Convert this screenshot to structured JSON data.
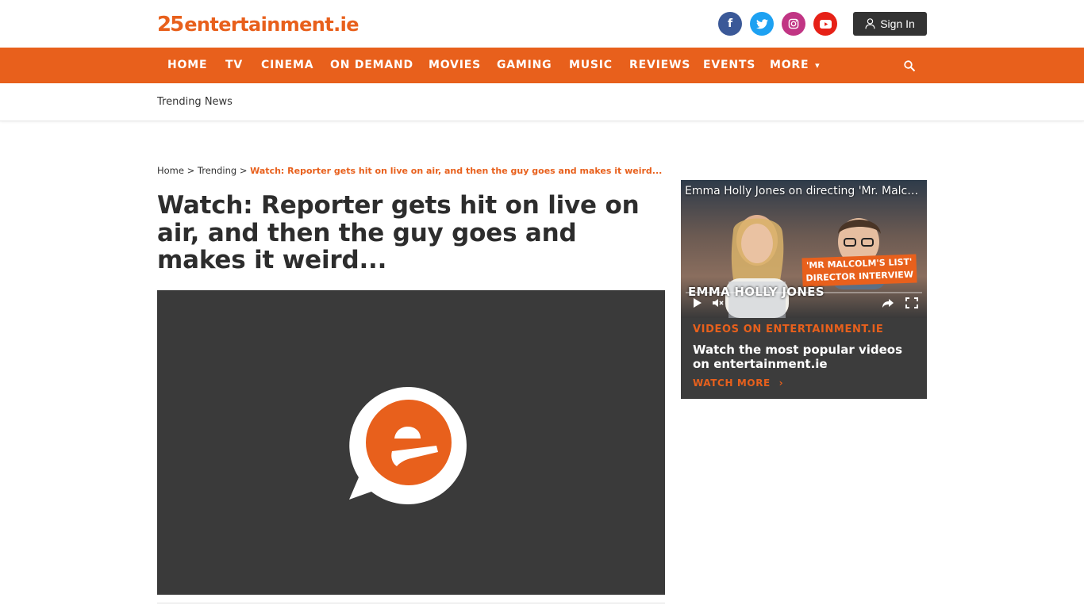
{
  "header": {
    "logo_number": "25",
    "logo_text": "entertainment.ie",
    "social": [
      {
        "icon": "facebook-icon",
        "glyph": "f"
      },
      {
        "icon": "twitter-icon",
        "glyph": ""
      },
      {
        "icon": "instagram-icon",
        "glyph": ""
      },
      {
        "icon": "youtube-icon",
        "glyph": ""
      }
    ],
    "signin_label": "Sign In"
  },
  "nav": {
    "items": [
      "HOME",
      "TV",
      "CINEMA",
      "ON DEMAND",
      "MOVIES",
      "GAMING",
      "MUSIC",
      "REVIEWS",
      "EVENTS",
      "MORE"
    ],
    "more_caret": "▾",
    "search_icon": "search-icon"
  },
  "subnav": {
    "trending_label": "Trending News"
  },
  "breadcrumb": {
    "home": "Home",
    "sep": ">",
    "section": "Trending",
    "current": "Watch: Reporter gets hit on live on air, and then the guy goes and makes it weird..."
  },
  "article": {
    "title": "Watch: Reporter gets hit on live on air, and then the guy goes and makes it weird..."
  },
  "sidebar": {
    "video_title": "Emma Holly Jones on directing 'Mr. Malcolm's List'",
    "badge_line1": "'MR MALCOLM'S LIST'",
    "badge_line2": "DIRECTOR INTERVIEW",
    "name_overlay": "EMMA HOLLY JONES",
    "kicker": "VIDEOS ON ENTERTAINMENT.IE",
    "text": "Watch the most popular videos on entertainment.ie",
    "more_label": "WATCH MORE",
    "more_chevron": "›"
  },
  "colors": {
    "accent": "#e8601c",
    "dark": "#2d2d2d",
    "video_bg": "#3a3a3a"
  }
}
